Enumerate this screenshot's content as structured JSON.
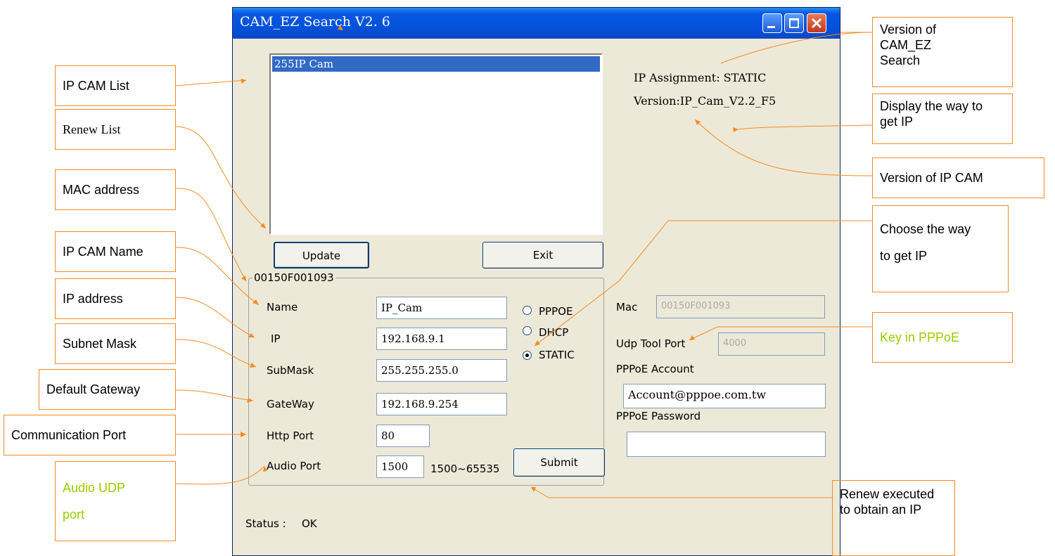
{
  "window": {
    "title": "CAM_EZ Search V2. 6",
    "buttons": [
      "minimize-icon",
      "maximize-icon",
      "close-icon"
    ]
  },
  "list": {
    "items": [
      "255IP Cam"
    ],
    "selected_index": 0
  },
  "info": {
    "ip_assignment": "IP Assignment: STATIC",
    "version": "Version:IP_Cam_V2.2_F5"
  },
  "buttons": {
    "update": "Update",
    "exit": "Exit",
    "submit": "Submit"
  },
  "group": {
    "title": "00150F001093",
    "fields": {
      "name": {
        "label": "Name",
        "value": "IP_Cam"
      },
      "ip": {
        "label": "IP",
        "value": "192.168.9.1"
      },
      "submask": {
        "label": "SubMask",
        "value": "255.255.255.0"
      },
      "gateway": {
        "label": "GateWay",
        "value": "192.168.9.254"
      },
      "http_port": {
        "label": "Http Port",
        "value": "80"
      },
      "audio_port": {
        "label": "Audio Port",
        "value": "1500",
        "range": "1500~65535"
      }
    },
    "radio": {
      "options": [
        "PPPOE",
        "DHCP",
        "STATIC"
      ],
      "selected": "STATIC"
    }
  },
  "right": {
    "mac": {
      "label": "Mac",
      "value": "00150F001093"
    },
    "udp": {
      "label": "Udp Tool Port",
      "value": "4000"
    },
    "pppoe_account": {
      "label": "PPPoE Account",
      "value": "Account@pppoe.com.tw"
    },
    "pppoe_password": {
      "label": "PPPoE Password",
      "value": ""
    }
  },
  "status": {
    "label": "Status :",
    "value": "OK"
  },
  "annotations": {
    "ip_cam_list": "IP CAM List",
    "renew_list": "Renew List",
    "mac_address": "MAC address",
    "ip_cam_name": "IP CAM Name",
    "ip_address": "IP address",
    "subnet_mask": "Subnet Mask",
    "default_gateway": "Default Gateway",
    "communication_port": "Communication Port",
    "audio_udp_port": "Audio UDP port",
    "version_of_search": "Version of CAM_EZ Search",
    "display_way": "Display the way to get IP",
    "version_of_cam": "Version of IP CAM",
    "choose_way": "Choose the way to get IP",
    "key_in_pppoe": "Key in PPPoE",
    "renew_executed": "Renew executed to obtain an IP"
  },
  "colors": {
    "annotation_border": "#f68b1f",
    "annotation_green": "#99cc00",
    "window_bg": "#ece9d8",
    "titlebar": "#0352dc",
    "selection": "#316ac5"
  }
}
